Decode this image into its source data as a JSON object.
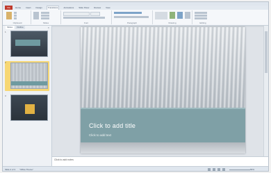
{
  "ribbon": {
    "file_tab": "File",
    "tabs": [
      "Home",
      "Insert",
      "Design",
      "Transitions",
      "Animations",
      "Slide Show",
      "Review",
      "View"
    ],
    "active_tab": "Transitions",
    "groups": [
      "Clipboard",
      "Slides",
      "Font",
      "Paragraph",
      "Drawing",
      "Editing"
    ]
  },
  "pane": {
    "tab_slides": "Slides",
    "tab_outline": "Outline",
    "close": "×",
    "thumbnails": [
      {
        "num": "1"
      },
      {
        "num": "2"
      },
      {
        "num": "3"
      }
    ]
  },
  "slide": {
    "title_placeholder": "Click to add title",
    "subtitle_placeholder": "Click to add text"
  },
  "notes": {
    "placeholder": "Click to add notes"
  },
  "status": {
    "slide_info": "Slide 2 of 3",
    "theme": "\"Office Theme\"",
    "zoom": "56%"
  },
  "colors": {
    "accent_band": "#7fa0a6",
    "file_tab": "#c0392b",
    "selected_thumb": "#f7d774"
  }
}
